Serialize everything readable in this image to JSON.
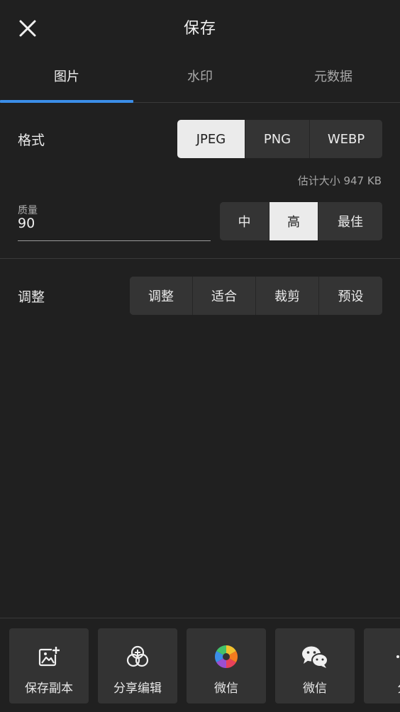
{
  "header": {
    "title": "保存",
    "close_icon": "close-icon"
  },
  "tabs": [
    {
      "label": "图片",
      "active": true
    },
    {
      "label": "水印",
      "active": false
    },
    {
      "label": "元数据",
      "active": false
    }
  ],
  "accent_color": "#3b8ee8",
  "format": {
    "label": "格式",
    "options": [
      "JPEG",
      "PNG",
      "WEBP"
    ],
    "selected": "JPEG"
  },
  "size_estimate": "估计大小 947 KB",
  "quality": {
    "caption": "质量",
    "value": "90",
    "options": [
      "中",
      "高",
      "最佳"
    ],
    "selected": "高"
  },
  "adjust": {
    "label": "调整",
    "options": [
      "调整",
      "适合",
      "裁剪",
      "预设"
    ]
  },
  "actions": [
    {
      "label": "保存副本",
      "icon": "image-add-icon"
    },
    {
      "label": "分享编辑",
      "icon": "share-edit-icon"
    },
    {
      "label": "微信",
      "icon": "color-aperture-icon"
    },
    {
      "label": "微信",
      "icon": "wechat-icon"
    },
    {
      "label": "分",
      "icon": "more-icon"
    }
  ]
}
